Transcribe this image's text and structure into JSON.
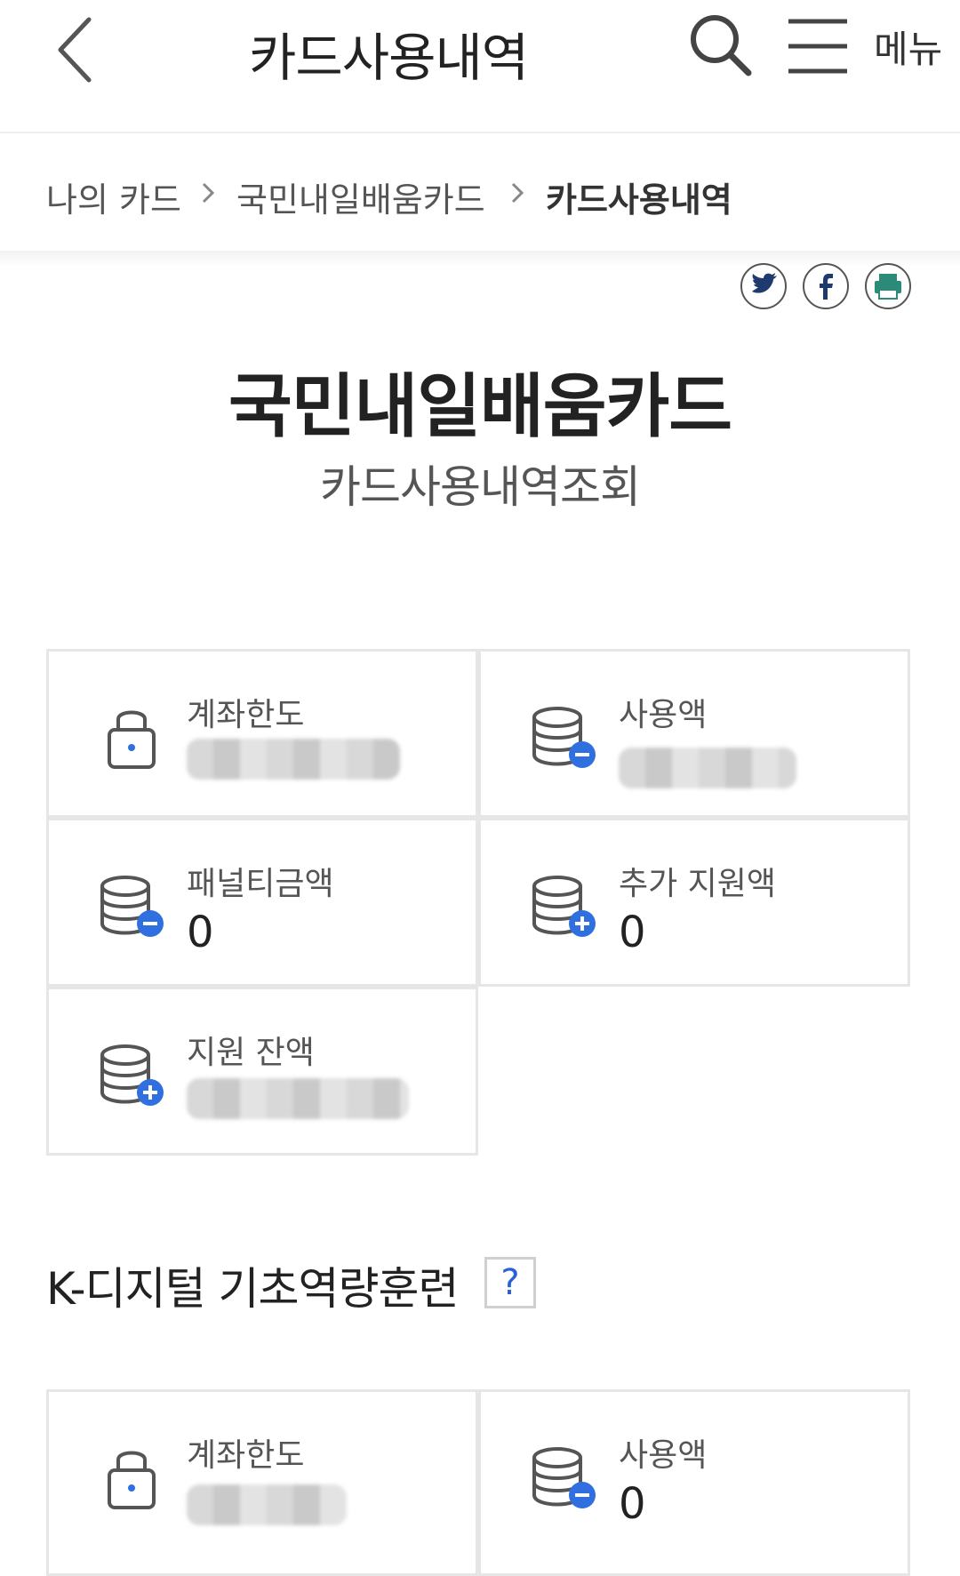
{
  "header": {
    "title": "카드사용내역",
    "menu_label": "메뉴"
  },
  "breadcrumb": {
    "items": [
      "나의 카드",
      "국민내일배움카드",
      "카드사용내역"
    ]
  },
  "page": {
    "title": "국민내일배움카드",
    "subtitle": "카드사용내역조회"
  },
  "summary": {
    "account_limit_label": "계좌한도",
    "used_label": "사용액",
    "penalty_label": "패널티금액",
    "penalty_value": "0",
    "extra_support_label": "추가 지원액",
    "extra_support_value": "0",
    "support_balance_label": "지원 잔액"
  },
  "section2": {
    "title": "K-디지털 기초역량훈련",
    "help_label": "?",
    "account_limit_label": "계좌한도",
    "used_label": "사용액",
    "used_value": "0"
  },
  "colors": {
    "accent_blue": "#2f6fdf",
    "print_green": "#2b8a78",
    "border": "#e6e6e6"
  }
}
